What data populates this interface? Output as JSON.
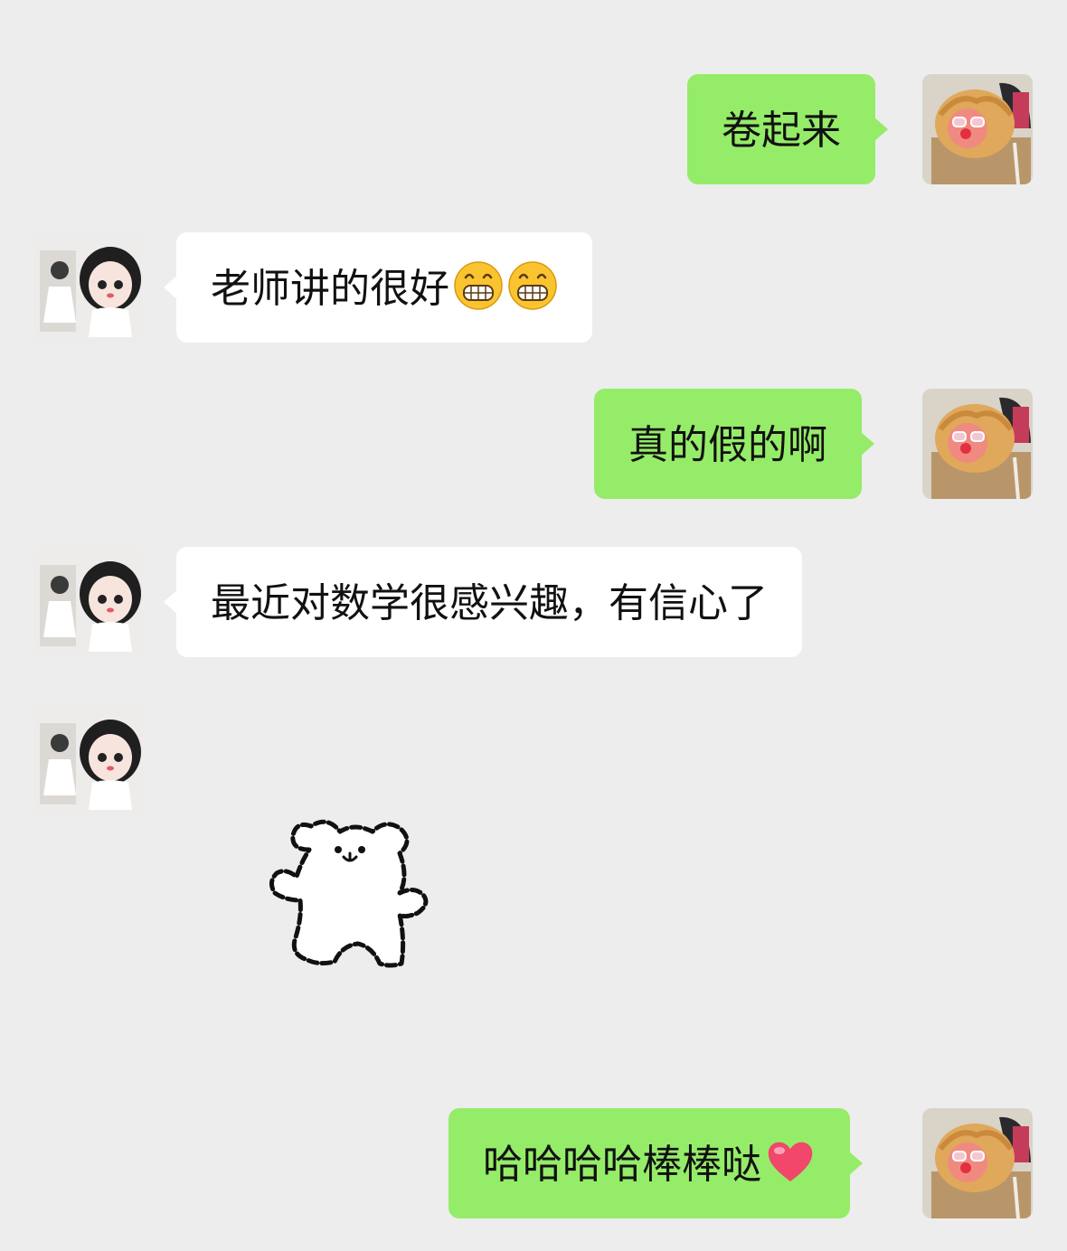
{
  "messages": [
    {
      "side": "right",
      "text": "卷起来"
    },
    {
      "side": "left",
      "text": "老师讲的很好"
    },
    {
      "side": "right",
      "text": "真的假的啊"
    },
    {
      "side": "left",
      "text": "最近对数学很感兴趣，有信心了"
    },
    {
      "side": "left",
      "type": "sticker",
      "sticker": "white-bear-waving-sticker"
    },
    {
      "side": "right",
      "text": "哈哈哈哈棒棒哒"
    }
  ],
  "emojis": {
    "grin": "grinning-face-emoji",
    "heart": "red-heart-emoji"
  },
  "colors": {
    "background": "#ededed",
    "self_bubble": "#95ec69",
    "other_bubble": "#ffffff",
    "text": "#111111"
  }
}
